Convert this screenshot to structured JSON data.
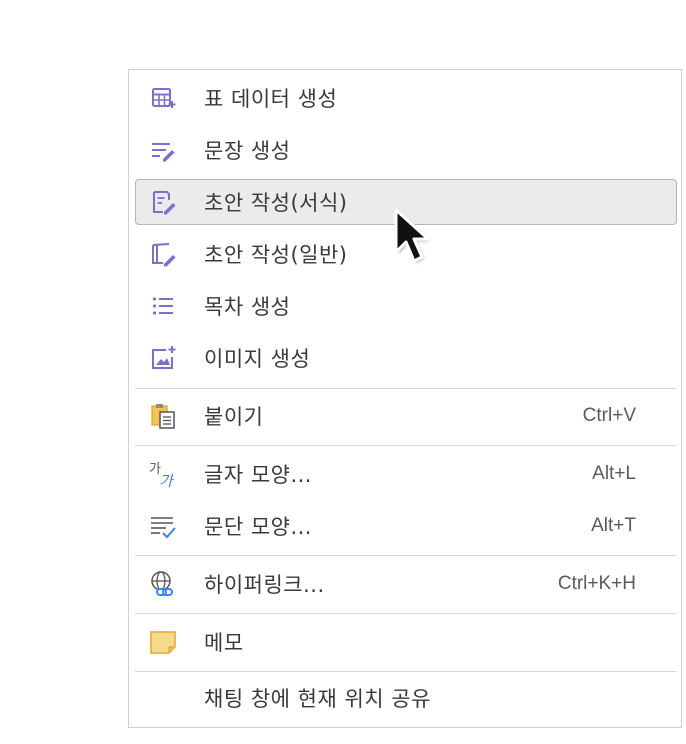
{
  "menu": {
    "items": [
      {
        "label": "표 데이터 생성",
        "icon": "table-sparkle-icon"
      },
      {
        "label": "문장 생성",
        "icon": "lines-pen-icon"
      },
      {
        "label": "초안 작성(서식)",
        "icon": "document-pen-icon"
      },
      {
        "label": "초안 작성(일반)",
        "icon": "card-pen-icon"
      },
      {
        "label": "목차 생성",
        "icon": "list-icon"
      },
      {
        "label": "이미지 생성",
        "icon": "image-sparkle-icon"
      },
      {
        "label": "붙이기",
        "shortcut": "Ctrl+V",
        "icon": "clipboard-icon"
      },
      {
        "label": "글자 모양...",
        "shortcut": "Alt+L",
        "icon": "character-shape-icon"
      },
      {
        "label": "문단 모양...",
        "shortcut": "Alt+T",
        "icon": "paragraph-shape-icon"
      },
      {
        "label": "하이퍼링크...",
        "shortcut": "Ctrl+K+H",
        "icon": "globe-link-icon"
      },
      {
        "label": "메모",
        "icon": "memo-icon"
      },
      {
        "label": "채팅 창에 현재 위치 공유",
        "icon": ""
      }
    ],
    "active_item": "초안 작성(서식)"
  },
  "colors": {
    "ai_icon": "#7b6fd6",
    "memo": "#f2c04b",
    "link_blue": "#3b82f6",
    "highlight_bg": "#ebebeb"
  }
}
